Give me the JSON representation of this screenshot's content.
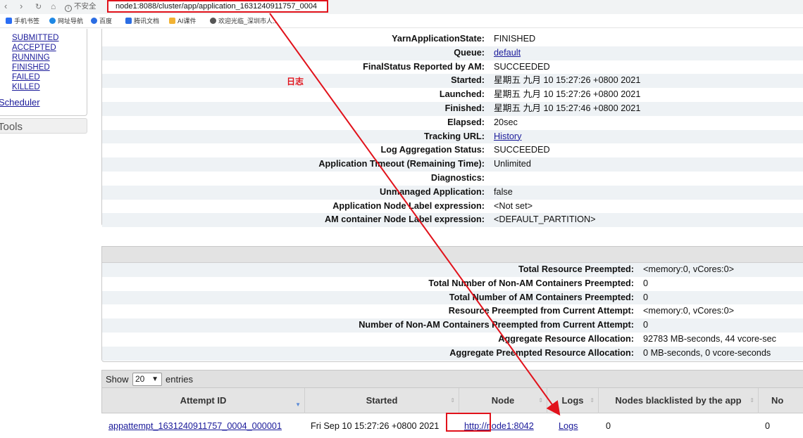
{
  "browser": {
    "nav": {
      "back": "‹",
      "forward": "›",
      "reload": "↻",
      "home": "⌂"
    },
    "security_text": "不安全",
    "url": "node1:8088/cluster/app/application_1631240911757_0004",
    "bookmarks": [
      "手机书签",
      "网址导航",
      "百度",
      "腾讯文档",
      "AI课件",
      "欢迎光临_深圳市人..."
    ],
    "bookmark_icon_colors": [
      "#2a6df4",
      "#1e88e5",
      "#2b6de3",
      "#2b6de3",
      "#f2b233",
      "#555555"
    ]
  },
  "sidebar": {
    "states": [
      "SUBMITTED",
      "ACCEPTED",
      "RUNNING",
      "FINISHED",
      "FAILED",
      "KILLED"
    ],
    "scheduler": "Scheduler",
    "tools": "Tools"
  },
  "overview": {
    "rows": [
      {
        "label": "YarnApplicationState:",
        "value": "FINISHED",
        "link": false
      },
      {
        "label": "Queue:",
        "value": "default",
        "link": true
      },
      {
        "label": "FinalStatus Reported by AM:",
        "value": "SUCCEEDED",
        "link": false
      },
      {
        "label": "Started:",
        "value": "星期五 九月 10 15:27:26 +0800 2021",
        "link": false
      },
      {
        "label": "Launched:",
        "value": "星期五 九月 10 15:27:26 +0800 2021",
        "link": false
      },
      {
        "label": "Finished:",
        "value": "星期五 九月 10 15:27:46 +0800 2021",
        "link": false
      },
      {
        "label": "Elapsed:",
        "value": "20sec",
        "link": false
      },
      {
        "label": "Tracking URL:",
        "value": "History",
        "link": true
      },
      {
        "label": "Log Aggregation Status:",
        "value": "SUCCEEDED",
        "link": false
      },
      {
        "label": "Application Timeout (Remaining Time):",
        "value": "Unlimited",
        "link": false
      },
      {
        "label": "Diagnostics:",
        "value": "",
        "link": false
      },
      {
        "label": "Unmanaged Application:",
        "value": "false",
        "link": false
      },
      {
        "label": "Application Node Label expression:",
        "value": "<Not set>",
        "link": false
      },
      {
        "label": "AM container Node Label expression:",
        "value": "<DEFAULT_PARTITION>",
        "link": false
      }
    ]
  },
  "preemption": {
    "rows": [
      {
        "label": "Total Resource Preempted:",
        "value": "<memory:0, vCores:0>"
      },
      {
        "label": "Total Number of Non-AM Containers Preempted:",
        "value": "0"
      },
      {
        "label": "Total Number of AM Containers Preempted:",
        "value": "0"
      },
      {
        "label": "Resource Preempted from Current Attempt:",
        "value": "<memory:0, vCores:0>"
      },
      {
        "label": "Number of Non-AM Containers Preempted from Current Attempt:",
        "value": "0"
      },
      {
        "label": "Aggregate Resource Allocation:",
        "value": "92783 MB-seconds, 44 vcore-sec"
      },
      {
        "label": "Aggregate Preempted Resource Allocation:",
        "value": "0 MB-seconds, 0 vcore-seconds"
      }
    ]
  },
  "attempts": {
    "show_label": "Show",
    "page_size": "20",
    "entries_label": "entries",
    "columns": [
      "Attempt ID",
      "Started",
      "Node",
      "Logs",
      "Nodes blacklisted by the app",
      "No"
    ],
    "row": {
      "attempt_id": "appattempt_1631240911757_0004_000001",
      "started": "Fri Sep 10 15:27:26 +0800 2021",
      "node": "http://node1:8042",
      "logs": "Logs",
      "blacklisted_app": "0",
      "blacklisted_system": "0"
    }
  },
  "annotation": {
    "label": "日志",
    "color": "#e1121b"
  }
}
